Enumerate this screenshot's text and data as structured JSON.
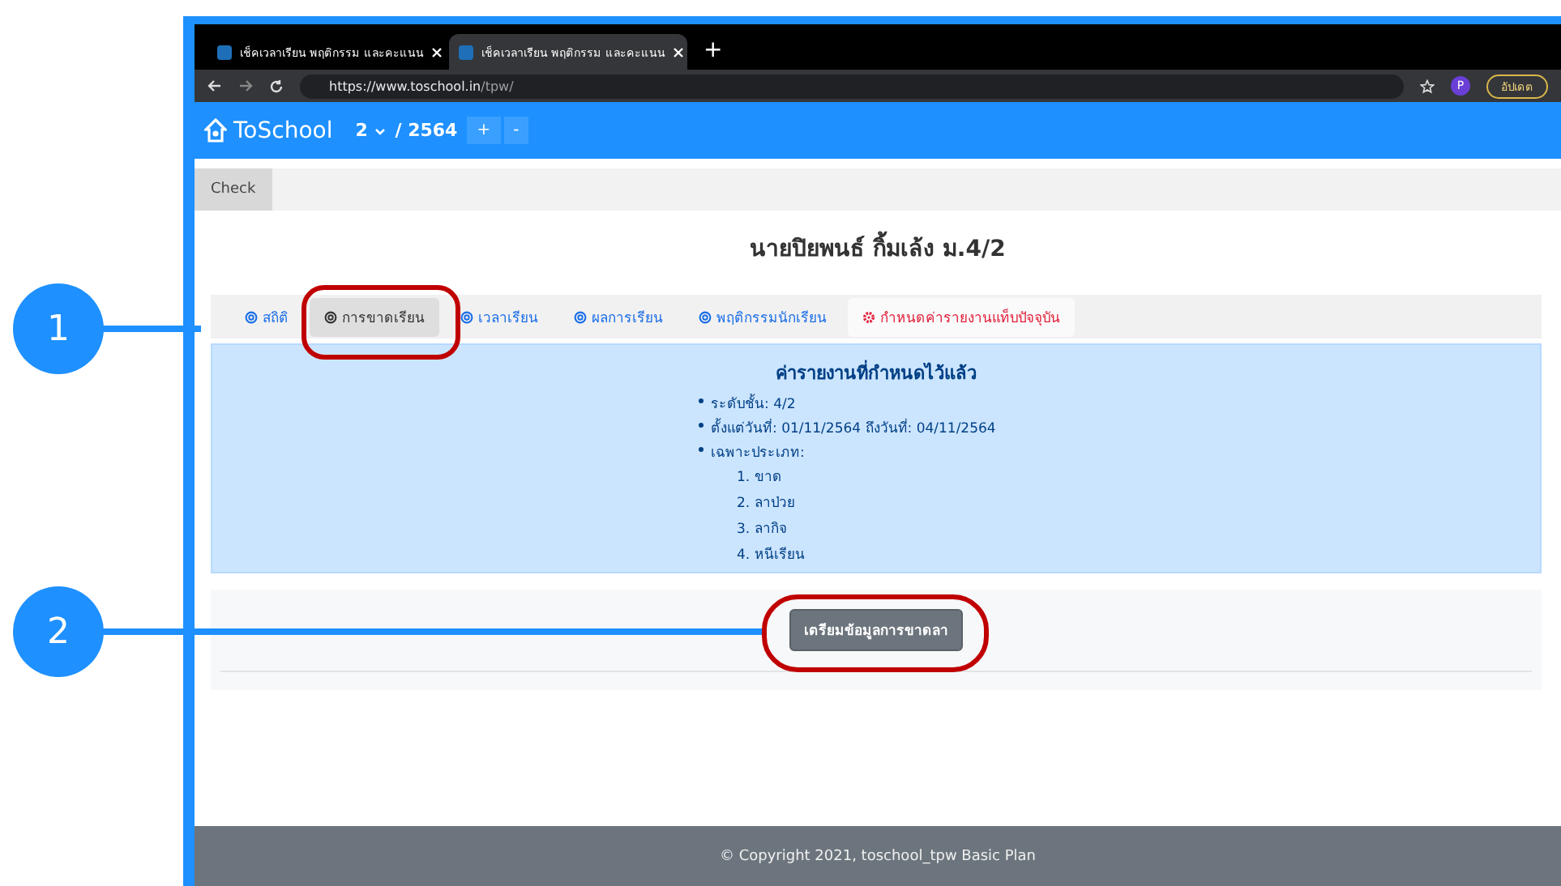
{
  "browser": {
    "tabs": [
      {
        "title": "เช็คเวลาเรียน พฤติกรรม และคะแนน",
        "selected": false
      },
      {
        "title": "เช็คเวลาเรียน พฤติกรรม และคะแนน",
        "selected": true
      }
    ],
    "new_tab": "+",
    "url_host": "https://www.toschool.in",
    "url_path": "/tpw/",
    "profile": "P",
    "update_button": "อัปเดต"
  },
  "navbar": {
    "brand": "ToSchool",
    "term": "2",
    "separator": "/",
    "year": "2564",
    "buttons": [
      "+",
      "-"
    ]
  },
  "subnav": {
    "items": [
      {
        "label": "Check",
        "selected": true
      }
    ]
  },
  "student_name": "นายปิยพนธ์ กิ้มเล้ง ม.4/2",
  "tabs": [
    {
      "label": "สถิติ",
      "selected": false,
      "kind": "normal"
    },
    {
      "label": "การขาดเรียน",
      "selected": true,
      "kind": "normal"
    },
    {
      "label": "เวลาเรียน",
      "selected": false,
      "kind": "normal"
    },
    {
      "label": "ผลการเรียน",
      "selected": false,
      "kind": "normal"
    },
    {
      "label": "พฤติกรรมนักเรียน",
      "selected": false,
      "kind": "normal"
    },
    {
      "label": "กำหนดค่ารายงานแท็บปัจจุบัน",
      "selected": false,
      "kind": "settings"
    }
  ],
  "report": {
    "title": "ค่ารายงานที่กำหนดไว้แล้ว",
    "items": [
      {
        "text": "ระดับชั้น: 4/2"
      },
      {
        "text": "ตั้งแต่วันที่: 01/11/2564 ถึงวันที่: 04/11/2564"
      },
      {
        "text": "เฉพาะประเภท:",
        "children": [
          "1. ขาด",
          "2. ลาป่วย",
          "3. ลากิจ",
          "4. หนีเรียน"
        ]
      }
    ]
  },
  "action_button": "เตรียมข้อมูลการขาดลา",
  "footer": "© Copyright 2021, toschool_tpw Basic Plan",
  "callouts": [
    {
      "number": "1"
    },
    {
      "number": "2"
    }
  ]
}
